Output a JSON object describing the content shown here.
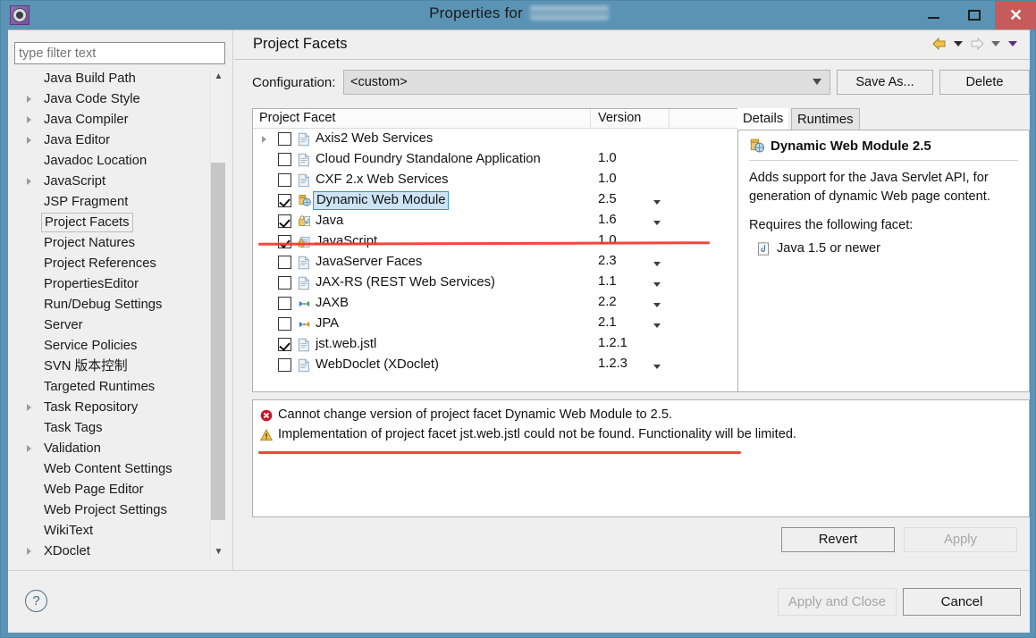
{
  "window": {
    "title_prefix": "Properties for",
    "project_name_redacted": "",
    "icon": "properties-gear-icon",
    "minimize_label": "—",
    "maximize_label": "□",
    "close_label": "✕"
  },
  "sidebar": {
    "filter_placeholder": "type filter text",
    "filter_value": "",
    "items": [
      {
        "label": "Java Build Path",
        "expandable": false,
        "selected": false
      },
      {
        "label": "Java Code Style",
        "expandable": true,
        "selected": false
      },
      {
        "label": "Java Compiler",
        "expandable": true,
        "selected": false
      },
      {
        "label": "Java Editor",
        "expandable": true,
        "selected": false
      },
      {
        "label": "Javadoc Location",
        "expandable": false,
        "selected": false
      },
      {
        "label": "JavaScript",
        "expandable": true,
        "selected": false
      },
      {
        "label": "JSP Fragment",
        "expandable": false,
        "selected": false
      },
      {
        "label": "Project Facets",
        "expandable": false,
        "selected": true
      },
      {
        "label": "Project Natures",
        "expandable": false,
        "selected": false
      },
      {
        "label": "Project References",
        "expandable": false,
        "selected": false
      },
      {
        "label": "PropertiesEditor",
        "expandable": false,
        "selected": false
      },
      {
        "label": "Run/Debug Settings",
        "expandable": false,
        "selected": false
      },
      {
        "label": "Server",
        "expandable": false,
        "selected": false
      },
      {
        "label": "Service Policies",
        "expandable": false,
        "selected": false
      },
      {
        "label": "SVN 版本控制",
        "expandable": false,
        "selected": false
      },
      {
        "label": "Targeted Runtimes",
        "expandable": false,
        "selected": false
      },
      {
        "label": "Task Repository",
        "expandable": true,
        "selected": false
      },
      {
        "label": "Task Tags",
        "expandable": false,
        "selected": false
      },
      {
        "label": "Validation",
        "expandable": true,
        "selected": false
      },
      {
        "label": "Web Content Settings",
        "expandable": false,
        "selected": false
      },
      {
        "label": "Web Page Editor",
        "expandable": false,
        "selected": false
      },
      {
        "label": "Web Project Settings",
        "expandable": false,
        "selected": false
      },
      {
        "label": "WikiText",
        "expandable": false,
        "selected": false
      },
      {
        "label": "XDoclet",
        "expandable": true,
        "selected": false
      }
    ]
  },
  "main": {
    "page_title": "Project Facets",
    "nav": {
      "back_icon": "back-arrow-icon",
      "back_menu_icon": "chevron-down-icon",
      "forward_icon": "forward-arrow-icon",
      "forward_menu_icon": "chevron-down-icon",
      "view_menu_icon": "chevron-down-icon"
    },
    "configuration": {
      "label": "Configuration:",
      "value": "<custom>",
      "save_as_label": "Save As...",
      "delete_label": "Delete"
    },
    "table": {
      "columns": [
        "Project Facet",
        "Version"
      ],
      "rows": [
        {
          "name": "Axis2 Web Services",
          "version": "",
          "checked": false,
          "expandable": true,
          "has_version_menu": false,
          "icon": "document-icon",
          "selected": false
        },
        {
          "name": "Cloud Foundry Standalone Application",
          "version": "1.0",
          "checked": false,
          "expandable": false,
          "has_version_menu": false,
          "icon": "document-icon",
          "selected": false
        },
        {
          "name": "CXF 2.x Web Services",
          "version": "1.0",
          "checked": false,
          "expandable": false,
          "has_version_menu": false,
          "icon": "document-icon",
          "selected": false
        },
        {
          "name": "Dynamic Web Module",
          "version": "2.5",
          "checked": true,
          "expandable": false,
          "has_version_menu": true,
          "icon": "web-module-locked-icon",
          "selected": true
        },
        {
          "name": "Java",
          "version": "1.6",
          "checked": true,
          "expandable": false,
          "has_version_menu": true,
          "icon": "java-locked-icon",
          "selected": false
        },
        {
          "name": "JavaScript",
          "version": "1.0",
          "checked": true,
          "expandable": false,
          "has_version_menu": false,
          "icon": "javascript-locked-icon",
          "selected": false
        },
        {
          "name": "JavaServer Faces",
          "version": "2.3",
          "checked": false,
          "expandable": false,
          "has_version_menu": true,
          "icon": "document-icon",
          "selected": false
        },
        {
          "name": "JAX-RS (REST Web Services)",
          "version": "1.1",
          "checked": false,
          "expandable": false,
          "has_version_menu": true,
          "icon": "document-icon",
          "selected": false
        },
        {
          "name": "JAXB",
          "version": "2.2",
          "checked": false,
          "expandable": false,
          "has_version_menu": true,
          "icon": "jaxb-arrows-icon",
          "selected": false
        },
        {
          "name": "JPA",
          "version": "2.1",
          "checked": false,
          "expandable": false,
          "has_version_menu": true,
          "icon": "jpa-arrows-icon",
          "selected": false
        },
        {
          "name": "jst.web.jstl",
          "version": "1.2.1",
          "checked": true,
          "expandable": false,
          "has_version_menu": false,
          "icon": "document-icon",
          "selected": false
        },
        {
          "name": "WebDoclet (XDoclet)",
          "version": "1.2.3",
          "checked": false,
          "expandable": false,
          "has_version_menu": true,
          "icon": "document-icon",
          "selected": false
        }
      ]
    },
    "details": {
      "tabs": [
        "Details",
        "Runtimes"
      ],
      "active_tab": "Details",
      "title": "Dynamic Web Module 2.5",
      "title_icon": "web-module-locked-icon",
      "description": "Adds support for the Java Servlet API, for generation of dynamic Web page content.",
      "requires_heading": "Requires the following facet:",
      "requires_item": "Java 1.5 or newer",
      "requires_item_icon": "java-facet-icon"
    },
    "messages": [
      {
        "severity": "error",
        "icon": "error-icon",
        "text": "Cannot change version of project facet Dynamic Web Module to 2.5."
      },
      {
        "severity": "warning",
        "icon": "warning-icon",
        "text": "Implementation of project facet jst.web.jstl could not be found. Functionality will be limited."
      }
    ],
    "revert_label": "Revert",
    "apply_label": "Apply",
    "apply_enabled": false,
    "revert_enabled": true
  },
  "footer": {
    "help_icon": "help-question-icon",
    "apply_and_close_label": "Apply and Close",
    "apply_and_close_enabled": false,
    "cancel_label": "Cancel",
    "cancel_enabled": true
  },
  "colors": {
    "titlebar": "#5b93b5",
    "close_button": "#c75b5b",
    "selection": "#cce4f4",
    "selection_border": "#3c93d4",
    "annotation_red": "#f5372b",
    "error_red": "#d0112b",
    "warning_yellow": "#e8a33d",
    "panel_bg": "#efefef"
  }
}
